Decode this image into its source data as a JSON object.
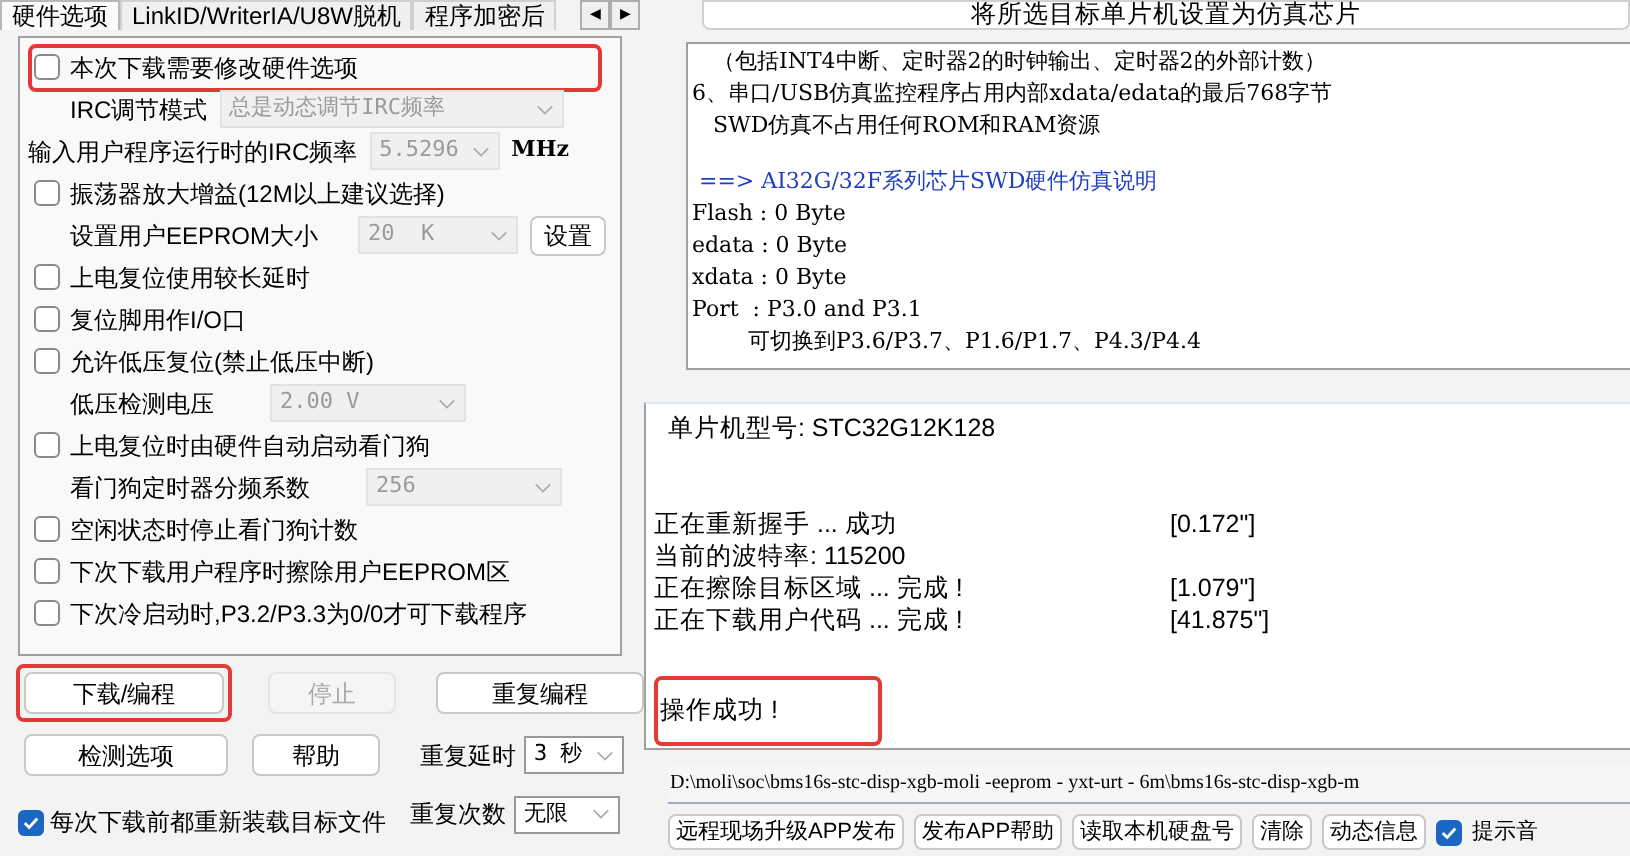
{
  "tabs": [
    {
      "label": "硬件选项",
      "selected": true
    },
    {
      "label": "LinkID/WriterIA/U8W脱机",
      "selected": false
    },
    {
      "label": "程序加密后",
      "selected": false
    }
  ],
  "tab_scroll": [
    "◀",
    "▶"
  ],
  "options": [
    {
      "kind": "check",
      "label": "本次下载需要修改硬件选项",
      "checked": false,
      "highlighted": true
    },
    {
      "kind": "select",
      "label": "IRC调节模式",
      "value": "总是动态调节IRC频率",
      "disabled": true
    },
    {
      "kind": "select",
      "label": "输入用户程序运行时的IRC频率",
      "value": "5.5296",
      "unit": "MHz",
      "disabled": true
    },
    {
      "kind": "check",
      "label": "振荡器放大增益(12M以上建议选择)",
      "checked": false,
      "highlighted": false
    },
    {
      "kind": "select",
      "label": "设置用户EEPROM大小",
      "value": "20  K",
      "button": "设置",
      "disabled": true
    },
    {
      "kind": "check",
      "label": "上电复位使用较长延时",
      "checked": false,
      "highlighted": false
    },
    {
      "kind": "check",
      "label": "复位脚用作I/O口",
      "checked": false,
      "highlighted": false
    },
    {
      "kind": "check",
      "label": "允许低压复位(禁止低压中断)",
      "checked": false,
      "highlighted": false
    },
    {
      "kind": "select",
      "label": "低压检测电压",
      "value": "2.00 V",
      "disabled": true
    },
    {
      "kind": "check",
      "label": "上电复位时由硬件自动启动看门狗",
      "checked": false,
      "highlighted": false
    },
    {
      "kind": "select",
      "label": "看门狗定时器分频系数",
      "value": "256",
      "disabled": true
    },
    {
      "kind": "check",
      "label": "空闲状态时停止看门狗计数",
      "checked": false,
      "highlighted": false
    },
    {
      "kind": "check",
      "label": "下次下载用户程序时擦除用户EEPROM区",
      "checked": false,
      "highlighted": false
    },
    {
      "kind": "check",
      "label": "下次冷启动时,P3.2/P3.3为0/0才可下载程序",
      "checked": false,
      "highlighted": false
    }
  ],
  "actions": [
    {
      "label": "下载/编程",
      "disabled": false,
      "highlighted": true
    },
    {
      "label": "停止",
      "disabled": true,
      "highlighted": false
    },
    {
      "label": "重复编程",
      "disabled": false,
      "highlighted": false
    },
    {
      "label": "检测选项",
      "disabled": false,
      "highlighted": false
    },
    {
      "label": "帮助",
      "disabled": false,
      "highlighted": false
    }
  ],
  "repeat_delay": {
    "label": "重复延时",
    "value": "3 秒"
  },
  "repeat_count": {
    "label": "重复次数",
    "value": "无限"
  },
  "reload_option": {
    "label": "每次下载前都重新装载目标文件",
    "checked": true
  },
  "emulator_button": "将所选目标单片机设置为仿真芯片",
  "info_lines": [
    {
      "kind": "text",
      "text": "   （包括INT4中断、定时器2的时钟输出、定时器2的外部计数）"
    },
    {
      "kind": "text",
      "text": "6、串口/USB仿真监控程序占用内部xdata/edata的最后768字节"
    },
    {
      "kind": "text",
      "text": "   SWD仿真不占用任何ROM和RAM资源"
    },
    {
      "kind": "blank"
    },
    {
      "kind": "link",
      "text": " ==> AI32G/32F系列芯片SWD硬件仿真说明"
    },
    {
      "kind": "text",
      "text": "Flash : 0 Byte"
    },
    {
      "kind": "text",
      "text": "edata : 0 Byte"
    },
    {
      "kind": "text",
      "text": "xdata : 0 Byte"
    },
    {
      "kind": "text",
      "text": "Port  : P3.0 and P3.1"
    },
    {
      "kind": "text",
      "text": "        可切换到P3.6/P3.7、P1.6/P1.7、P4.3/P4.4"
    }
  ],
  "log_lines": [
    {
      "kind": "entry",
      "text": "  单片机型号: STC32G12K128"
    },
    {
      "kind": "blank"
    },
    {
      "kind": "blank"
    },
    {
      "kind": "entry",
      "text": "正在重新握手 ... 成功",
      "time": "[0.172\"]"
    },
    {
      "kind": "entry",
      "text": "当前的波特率: 115200"
    },
    {
      "kind": "entry",
      "text": "正在擦除目标区域 ... 完成 !",
      "time": "[1.079\"]"
    },
    {
      "kind": "entry",
      "text": "正在下载用户代码 ... 完成 !",
      "time": "[41.875\"]"
    }
  ],
  "result": {
    "text": "操作成功 !",
    "highlighted": true
  },
  "file_path": "D:\\moli\\soc\\bms16s-stc-disp-xgb-moli -eeprom - yxt-urt - 6m\\bms16s-stc-disp-xgb-m",
  "bottom_buttons": [
    "远程现场升级APP发布",
    "发布APP帮助",
    "读取本机硬盘号",
    "清除",
    "动态信息"
  ],
  "sound_option": {
    "label": "提示音",
    "checked": true
  }
}
